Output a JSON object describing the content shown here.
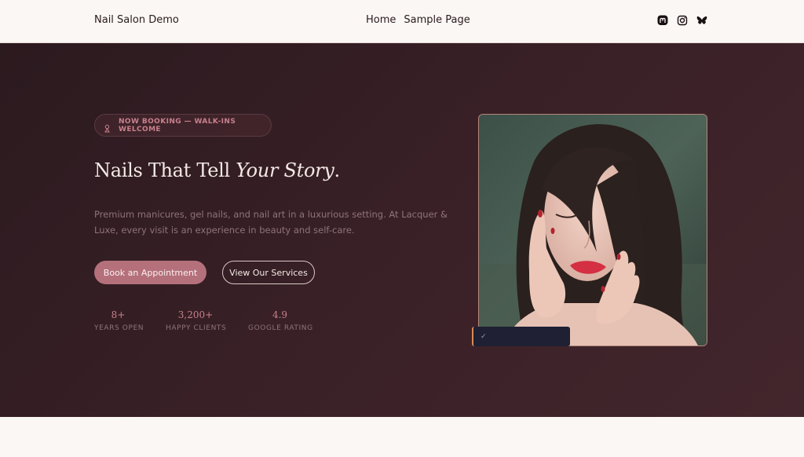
{
  "header": {
    "site_title": "Nail Salon Demo",
    "nav": [
      {
        "label": "Home"
      },
      {
        "label": "Sample Page"
      }
    ],
    "social": [
      "mastodon-icon",
      "instagram-icon",
      "bluesky-icon"
    ]
  },
  "hero": {
    "badge": "NOW BOOKING — WALK-INS WELCOME",
    "title_main": "Nails That Tell",
    "title_italic": "Your Story",
    "title_end": ".",
    "description": "Premium manicures, gel nails, and nail art in a luxurious setting. At Lacquer & Luxe, every visit is an experience in beauty and self-care.",
    "primary_button": "Book an Appointment",
    "secondary_button": "View Our Services",
    "stats": [
      {
        "value": "8+",
        "label": "YEARS OPEN"
      },
      {
        "value": "3,200+",
        "label": "HAPPY CLIENTS"
      },
      {
        "value": "4.9",
        "label": "GOOGLE RATING"
      }
    ],
    "overlay_check": "✓"
  },
  "colors": {
    "accent": "#b5717b",
    "hero_bg": "#2b1a1f",
    "page_bg": "#fbf7f4"
  }
}
